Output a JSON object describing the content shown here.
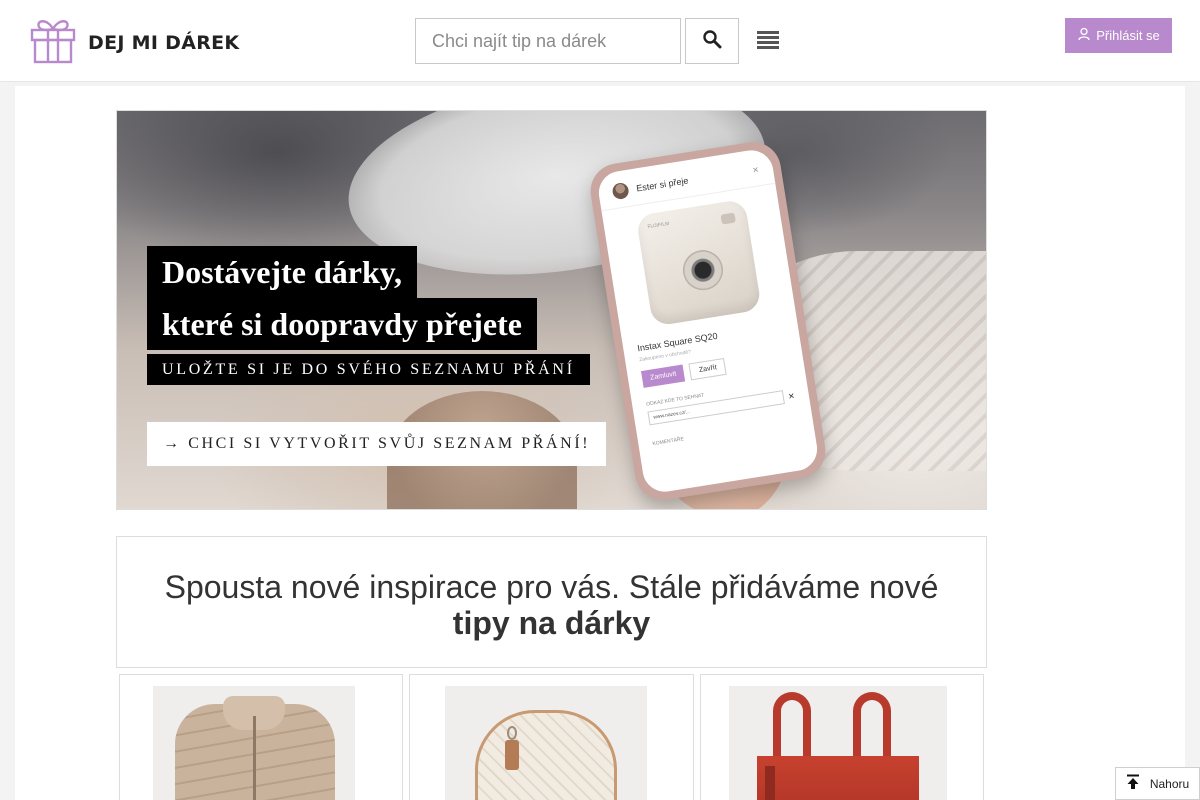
{
  "header": {
    "logo_text": "DEJ MI DÁREK",
    "search_placeholder": "Chci najít tip na dárek",
    "login_label": "Přihlásit se"
  },
  "hero": {
    "line1": "Dostávejte dárky,",
    "line2": "které si doopravdy přejete",
    "subline": "ULOŽTE SI JE DO SVÉHO SEZNAMU PŘÁNÍ",
    "cta": "→ CHCI SI VYTVOŘIT SVŮJ SEZNAM PŘÁNÍ!",
    "phone": {
      "header": "Ester si přeje",
      "product": "Instax Square SQ20",
      "reserve": "Zamluvit",
      "close": "Zavřít",
      "camera_brand": "FUJIFILM",
      "note": "Zakoupeno v obchodě?",
      "share": "ODKAZ KDE TO SEHNAT",
      "url": "www.nazev.cz/...",
      "comments": "KOMENTÁŘE"
    }
  },
  "inspiration": {
    "line": "Spousta nové inspirace pro vás. Stále přidáváme nové",
    "bold": "tipy na dárky"
  },
  "products": [
    {
      "name": "jacket"
    },
    {
      "name": "backpack"
    },
    {
      "name": "handbag"
    }
  ],
  "back_to_top": {
    "label": "Nahoru"
  },
  "colors": {
    "accent": "#b889cc",
    "hero_label_bg": "#000000"
  }
}
